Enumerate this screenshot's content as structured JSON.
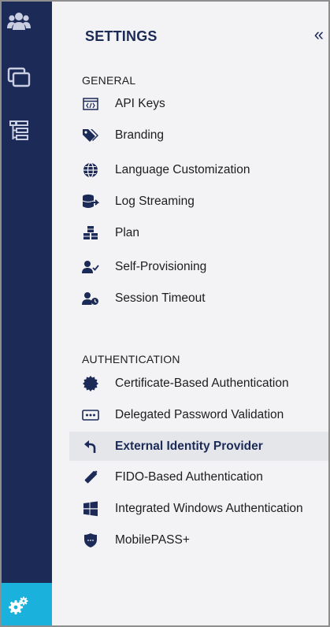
{
  "colors": {
    "rail": "#1b2a57",
    "rail_active": "#1ab2dc",
    "panel": "#f3f3f5",
    "active_item": "#e5e6ea",
    "text": "#1d1d1d"
  },
  "rail": {
    "icons": [
      "users-icon",
      "windows-icon",
      "tree-list-icon"
    ],
    "bottom_icon": "settings-gears-icon"
  },
  "panel": {
    "title": "SETTINGS",
    "collapse_glyph": "«"
  },
  "general": {
    "heading": "GENERAL",
    "items": [
      {
        "label": "API Keys",
        "icon": "api-keys-icon"
      },
      {
        "label": "Branding",
        "icon": "tags-icon"
      },
      {
        "label": "Language Customization",
        "icon": "globe-icon"
      },
      {
        "label": "Log Streaming",
        "icon": "database-export-icon"
      },
      {
        "label": "Plan",
        "icon": "cubes-icon"
      },
      {
        "label": "Self-Provisioning",
        "icon": "user-check-icon"
      },
      {
        "label": "Session Timeout",
        "icon": "user-clock-icon"
      }
    ]
  },
  "authentication": {
    "heading": "AUTHENTICATION",
    "items": [
      {
        "label": "Certificate-Based Authentication",
        "icon": "certificate-icon"
      },
      {
        "label": "Delegated Password Validation",
        "icon": "password-dots-icon"
      },
      {
        "label": "External Identity Provider",
        "icon": "external-arrow-icon",
        "active": true
      },
      {
        "label": "FIDO-Based Authentication",
        "icon": "usb-key-icon"
      },
      {
        "label": "Integrated Windows Authentication",
        "icon": "windows-logo-icon"
      },
      {
        "label": "MobilePASS+",
        "icon": "shield-icon"
      }
    ]
  }
}
